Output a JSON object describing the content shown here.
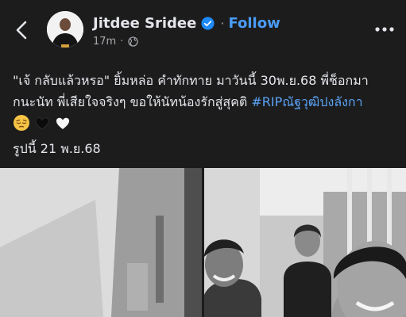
{
  "header": {
    "author": "Jitdee Sridee",
    "separator": "·",
    "follow_label": "Follow",
    "time": "17m",
    "icons": {
      "back": "chevron-left-icon",
      "verified": "verified-badge-icon",
      "audience": "globe-icon",
      "more": "more-horizontal-icon"
    },
    "accent_color": "#4a9cf7"
  },
  "post": {
    "line1": "\"เจ้ กลับแล้วหรอ\" ยิ้มหล่อ คำทักทาย มาวันนี้ 30พ.ย.68 พี่ช็อกมา",
    "line2_text": "กนะนัท พี่เสียใจจริงๆ ขอให้นัทน้องรักสู่สุคติ ",
    "hashtag": "#RIPณัฐวุฒิปงลังกา",
    "emojis": [
      "pensive-face",
      "black-heart",
      "white-heart"
    ],
    "caption": "รูปนี้ 21 พ.ย.68"
  },
  "photos": [
    {
      "name": "photo-left",
      "tone": "grayscale"
    },
    {
      "name": "photo-right",
      "tone": "grayscale"
    }
  ]
}
